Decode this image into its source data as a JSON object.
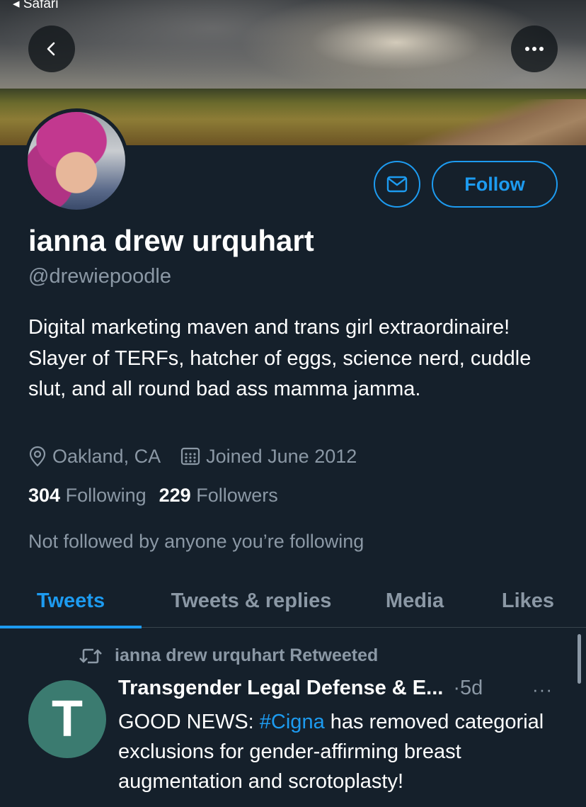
{
  "status_bar": {
    "back_app": "Safari"
  },
  "banner": {
    "alt": ""
  },
  "profile": {
    "name": "ianna drew urquhart",
    "handle": "@drewiepoodle",
    "bio": "Digital marketing maven and trans girl extraordinaire! Slayer of TERFs, hatcher of eggs, science nerd, cuddle slut, and all round bad ass mamma jamma.",
    "location": "Oakland, CA",
    "joined": "Joined June 2012",
    "following_count": "304",
    "following_label": "Following",
    "followers_count": "229",
    "followers_label": "Followers",
    "not_followed_text": "Not followed by anyone you’re following"
  },
  "actions": {
    "follow_label": "Follow"
  },
  "tabs": [
    {
      "label": "Tweets",
      "active": true
    },
    {
      "label": "Tweets & replies",
      "active": false
    },
    {
      "label": "Media",
      "active": false
    },
    {
      "label": "Likes",
      "active": false
    }
  ],
  "tweet": {
    "retweet_text": "ianna drew urquhart Retweeted",
    "avatar_letter": "T",
    "author": "Transgender Legal Defense & E...",
    "time": "·5d",
    "more": "···",
    "body_prefix": "GOOD NEWS: ",
    "hashtag": "#Cigna",
    "body_suffix": " has removed categorial exclusions for gender-affirming breast augmentation and scrotoplasty!"
  },
  "colors": {
    "background": "#15202b",
    "accent": "#1d9bf0",
    "secondary_text": "#8b98a5",
    "tweet_avatar": "#3b7b70"
  },
  "icons": {
    "back": "chevron-left-icon",
    "more": "more-horizontal-icon",
    "message": "envelope-icon",
    "location": "location-pin-icon",
    "calendar": "calendar-icon",
    "retweet": "retweet-icon"
  }
}
